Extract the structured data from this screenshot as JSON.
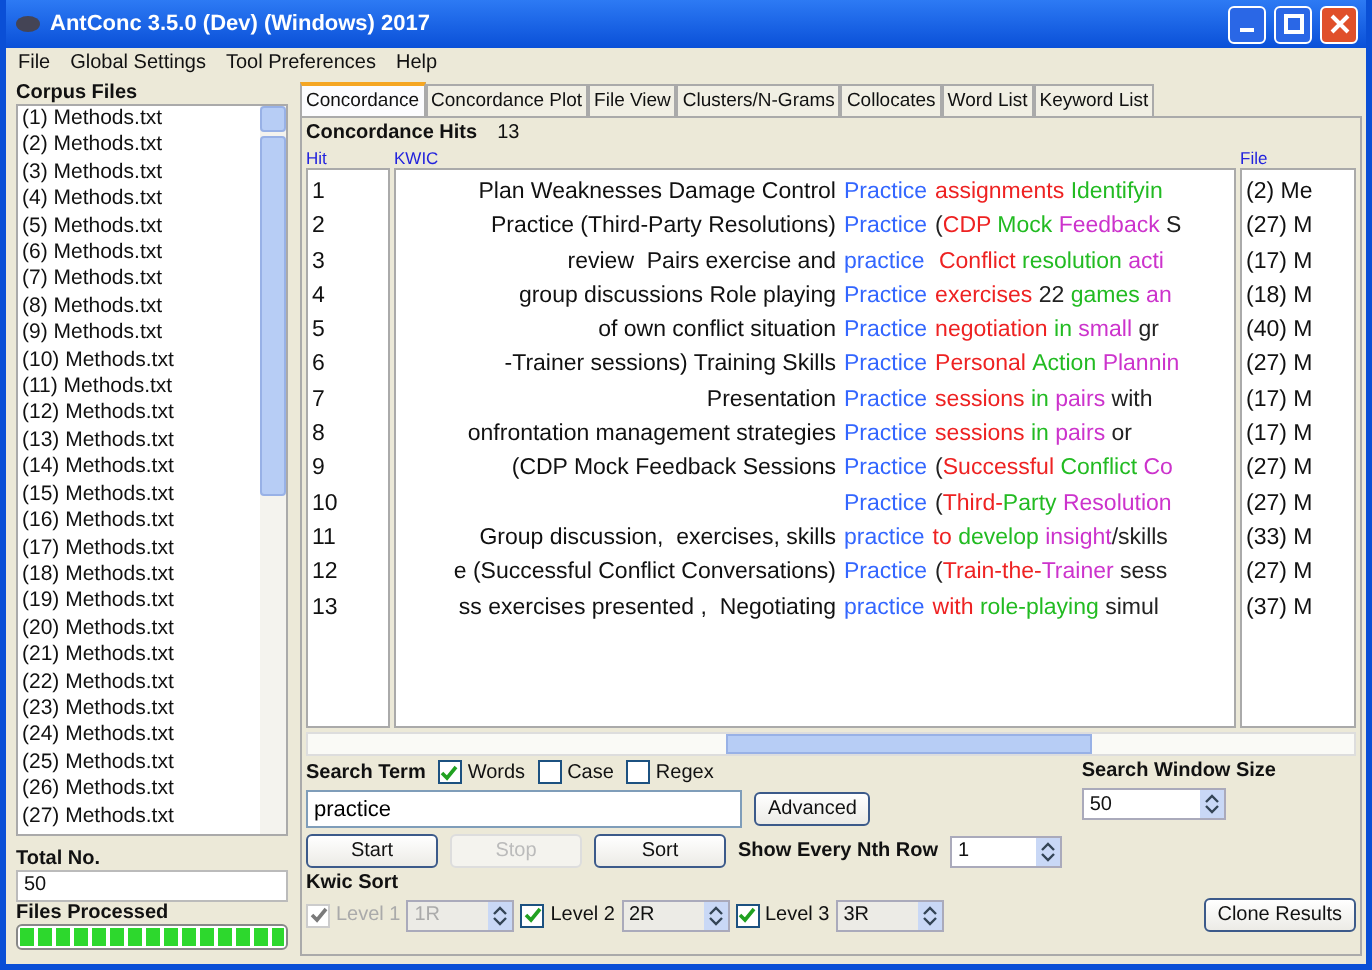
{
  "window": {
    "title": "AntConc 3.5.0 (Dev) (Windows) 2017"
  },
  "menu": [
    "File",
    "Global Settings",
    "Tool Preferences",
    "Help"
  ],
  "corpus": {
    "title": "Corpus Files",
    "files": [
      "(1) Methods.txt",
      "(2) Methods.txt",
      "(3) Methods.txt",
      "(4) Methods.txt",
      "(5) Methods.txt",
      "(6) Methods.txt",
      "(7) Methods.txt",
      "(8) Methods.txt",
      "(9) Methods.txt",
      "(10) Methods.txt",
      "(11) Methods.txt",
      "(12) Methods.txt",
      "(13) Methods.txt",
      "(14) Methods.txt",
      "(15) Methods.txt",
      "(16) Methods.txt",
      "(17) Methods.txt",
      "(18) Methods.txt",
      "(19) Methods.txt",
      "(20) Methods.txt",
      "(21) Methods.txt",
      "(22) Methods.txt",
      "(23) Methods.txt",
      "(24) Methods.txt",
      "(25) Methods.txt",
      "(26) Methods.txt",
      "(27) Methods.txt"
    ],
    "total_label": "Total No.",
    "total": "50",
    "processed_label": "Files Processed",
    "progress": {
      "level": 1
    }
  },
  "tabs": [
    {
      "label": "Concordance",
      "selected": true
    },
    {
      "label": "Concordance Plot",
      "selected": false
    },
    {
      "label": "File View",
      "selected": false
    },
    {
      "label": "Clusters/N-Grams",
      "selected": false
    },
    {
      "label": "Collocates",
      "selected": false
    },
    {
      "label": "Word List",
      "selected": false
    },
    {
      "label": "Keyword List",
      "selected": false
    }
  ],
  "hits_label": "Concordance Hits",
  "hits": "13",
  "columns": [
    "Hit",
    "KWIC",
    "File"
  ],
  "rows": [
    {
      "hit": "1",
      "left": "Plan Weaknesses Damage Control",
      "kw": "Practice",
      "right": [
        {
          "text": "assignments ",
          "color": "#ee2222"
        },
        {
          "text": "Identifyin",
          "color": "#22bb22"
        }
      ],
      "file": "(2) Me"
    },
    {
      "hit": "2",
      "left": "Practice (Third-Party Resolutions)",
      "kw": "Practice",
      "right": [
        {
          "text": "(",
          "color": "#222222"
        },
        {
          "text": "CDP ",
          "color": "#ee2222"
        },
        {
          "text": "Mock ",
          "color": "#22bb22"
        },
        {
          "text": "Feedback ",
          "color": "#cc33cc"
        },
        {
          "text": "S",
          "color": "#222222"
        }
      ],
      "file": "(27) M"
    },
    {
      "hit": "3",
      "left": "review  Pairs exercise and",
      "kw": "practice",
      "right": [
        {
          "text": " Conflict ",
          "color": "#ee2222"
        },
        {
          "text": "resolution ",
          "color": "#22bb22"
        },
        {
          "text": "acti",
          "color": "#cc33cc"
        }
      ],
      "file": "(17) M"
    },
    {
      "hit": "4",
      "left": "group discussions Role playing",
      "kw": "Practice",
      "right": [
        {
          "text": "exercises ",
          "color": "#ee2222"
        },
        {
          "text": "22 ",
          "color": "#222222"
        },
        {
          "text": "games ",
          "color": "#22bb22"
        },
        {
          "text": "an",
          "color": "#cc33cc"
        }
      ],
      "file": "(18) M"
    },
    {
      "hit": "5",
      "left": "of own conflict situation",
      "kw": "Practice",
      "right": [
        {
          "text": "negotiation ",
          "color": "#ee2222"
        },
        {
          "text": "in ",
          "color": "#22bb22"
        },
        {
          "text": "small ",
          "color": "#cc33cc"
        },
        {
          "text": "gr",
          "color": "#222222"
        }
      ],
      "file": "(40) M"
    },
    {
      "hit": "6",
      "left": "-Trainer sessions) Training Skills",
      "kw": "Practice",
      "right": [
        {
          "text": "Personal ",
          "color": "#ee2222"
        },
        {
          "text": "Action ",
          "color": "#22bb22"
        },
        {
          "text": "Plannin",
          "color": "#cc33cc"
        }
      ],
      "file": "(27) M"
    },
    {
      "hit": "7",
      "left": "Presentation",
      "kw": "Practice",
      "right": [
        {
          "text": "sessions ",
          "color": "#ee2222"
        },
        {
          "text": "in ",
          "color": "#22bb22"
        },
        {
          "text": "pairs ",
          "color": "#cc33cc"
        },
        {
          "text": "with",
          "color": "#222222"
        }
      ],
      "file": "(17) M"
    },
    {
      "hit": "8",
      "left": "onfrontation management strategies",
      "kw": "Practice",
      "right": [
        {
          "text": "sessions ",
          "color": "#ee2222"
        },
        {
          "text": "in ",
          "color": "#22bb22"
        },
        {
          "text": "pairs ",
          "color": "#cc33cc"
        },
        {
          "text": "or",
          "color": "#222222"
        }
      ],
      "file": "(17) M"
    },
    {
      "hit": "9",
      "left": "(CDP Mock Feedback Sessions",
      "kw": "Practice",
      "right": [
        {
          "text": "(",
          "color": "#222222"
        },
        {
          "text": "Successful ",
          "color": "#ee2222"
        },
        {
          "text": "Conflict ",
          "color": "#22bb22"
        },
        {
          "text": "Co",
          "color": "#cc33cc"
        }
      ],
      "file": "(27) M"
    },
    {
      "hit": "10",
      "left": "",
      "kw": "Practice",
      "right": [
        {
          "text": "(",
          "color": "#222222"
        },
        {
          "text": "Third-",
          "color": "#ee2222"
        },
        {
          "text": "Party ",
          "color": "#22bb22"
        },
        {
          "text": "Resolution",
          "color": "#cc33cc"
        }
      ],
      "file": "(27) M"
    },
    {
      "hit": "11",
      "left": "Group discussion,  exercises, skills",
      "kw": "practice",
      "right": [
        {
          "text": "to ",
          "color": "#ee2222"
        },
        {
          "text": "develop ",
          "color": "#22bb22"
        },
        {
          "text": "insight",
          "color": "#cc33cc"
        },
        {
          "text": "/skills",
          "color": "#222222"
        }
      ],
      "file": "(33) M"
    },
    {
      "hit": "12",
      "left": "e (Successful Conflict Conversations)",
      "kw": "Practice",
      "right": [
        {
          "text": "(",
          "color": "#222222"
        },
        {
          "text": "Train-the-",
          "color": "#ee2222"
        },
        {
          "text": "Trainer ",
          "color": "#cc33cc"
        },
        {
          "text": "sess",
          "color": "#222222"
        }
      ],
      "file": "(27) M"
    },
    {
      "hit": "13",
      "left": "ss exercises presented ,  Negotiating",
      "kw": "practice",
      "right": [
        {
          "text": "with ",
          "color": "#ee2222"
        },
        {
          "text": "role-playing ",
          "color": "#22bb22"
        },
        {
          "text": "simul",
          "color": "#222222"
        }
      ],
      "file": "(37) M"
    }
  ],
  "search": {
    "label": "Search Term",
    "options": [
      {
        "label": "Words",
        "checked": true
      },
      {
        "label": "Case",
        "checked": false
      },
      {
        "label": "Regex",
        "checked": false
      }
    ],
    "value": "practice",
    "advanced": "Advanced"
  },
  "buttons": [
    {
      "label": "Start",
      "disabled": false
    },
    {
      "label": "Stop",
      "disabled": true
    },
    {
      "label": "Sort",
      "disabled": false
    }
  ],
  "nth": {
    "label": "Show Every Nth Row",
    "value": "1"
  },
  "window_size": {
    "label": "Search Window Size",
    "value": "50"
  },
  "kwic_sort": {
    "label": "Kwic Sort",
    "levels": [
      {
        "label": "Level 1",
        "checked": true,
        "disabled": true,
        "value": "1R"
      },
      {
        "label": "Level 2",
        "checked": true,
        "disabled": false,
        "value": "2R"
      },
      {
        "label": "Level 3",
        "checked": true,
        "disabled": false,
        "value": "3R"
      }
    ]
  },
  "clone": "Clone Results"
}
